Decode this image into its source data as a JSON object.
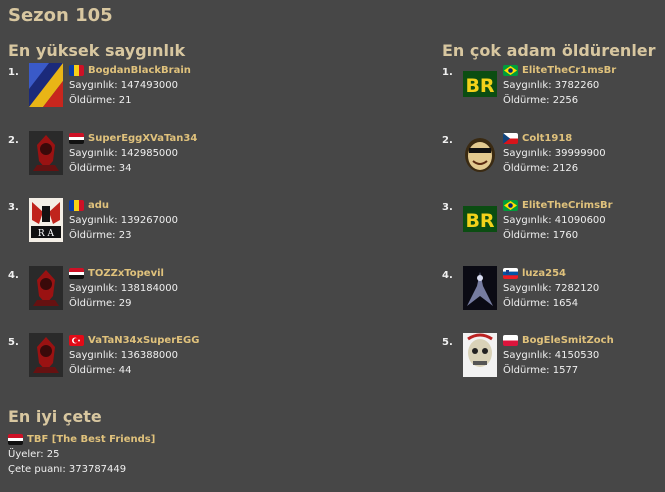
{
  "page": {
    "title": "Sezon 105"
  },
  "respect": {
    "heading": "En yüksek saygınlık",
    "entries": [
      {
        "rank": "1.",
        "name": "BogdanBlackBrain",
        "flag": "flag-romania",
        "respect": "Saygınlık: 147493000",
        "kills": "Öldürme: 21"
      },
      {
        "rank": "2.",
        "name": "SuperEggXVaTan34",
        "flag": "flag-egypt",
        "respect": "Saygınlık: 142985000",
        "kills": "Öldürme: 34"
      },
      {
        "rank": "3.",
        "name": "adu",
        "flag": "flag-romania",
        "respect": "Saygınlık: 139267000",
        "kills": "Öldürme: 23"
      },
      {
        "rank": "4.",
        "name": "TOZZxTopevil",
        "flag": "flag-egypt",
        "respect": "Saygınlık: 138184000",
        "kills": "Öldürme: 29"
      },
      {
        "rank": "5.",
        "name": "VaTaN34xSuperEGG",
        "flag": "flag-turkey",
        "respect": "Saygınlık: 136388000",
        "kills": "Öldürme: 44"
      }
    ]
  },
  "killers": {
    "heading": "En çok adam öldürenler",
    "entries": [
      {
        "rank": "1.",
        "name": "EliteTheCr1msBr",
        "flag": "flag-brazil",
        "respect": "Saygınlık: 3782260",
        "kills": "Öldürme: 2256"
      },
      {
        "rank": "2.",
        "name": "Colt1918",
        "flag": "flag-czech",
        "respect": "Saygınlık: 39999900",
        "kills": "Öldürme: 2126"
      },
      {
        "rank": "3.",
        "name": "EliteTheCrimsBr",
        "flag": "flag-brazil",
        "respect": "Saygınlık: 41090600",
        "kills": "Öldürme: 1760"
      },
      {
        "rank": "4.",
        "name": "luza254",
        "flag": "flag-slovenia",
        "respect": "Saygınlık: 7282120",
        "kills": "Öldürme: 1654"
      },
      {
        "rank": "5.",
        "name": "BogEleSmitZoch",
        "flag": "flag-poland",
        "respect": "Saygınlık: 4150530",
        "kills": "Öldürme: 1577"
      }
    ]
  },
  "gang": {
    "heading": "En iyi çete",
    "name": "TBF [The Best Friends]",
    "flag": "flag-egypt",
    "members": "Üyeler: 25",
    "points": "Çete puanı: 373787449"
  }
}
